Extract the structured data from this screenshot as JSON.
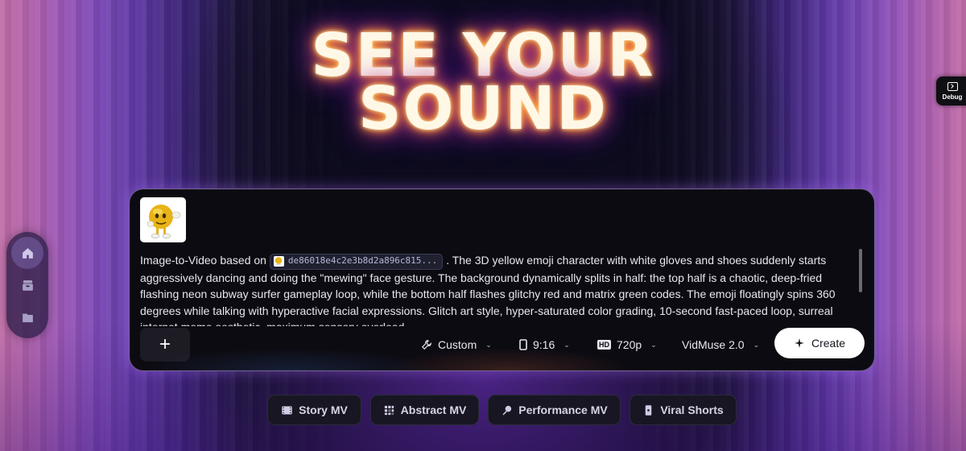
{
  "hero": {
    "line1": "SEE YOUR",
    "line2": "SOUND"
  },
  "debug": {
    "label": "Debug",
    "icon": "terminal-icon"
  },
  "left_rail": {
    "items": [
      {
        "name": "home",
        "icon": "home-icon",
        "active": true
      },
      {
        "name": "assets",
        "icon": "box-icon",
        "active": false
      },
      {
        "name": "files",
        "icon": "folder-icon",
        "active": false
      }
    ]
  },
  "composer": {
    "prompt_prefix": "Image-to-Video based on",
    "reference_chip": "de86018e4c2e3b8d2a896c815...",
    "prompt_body": ". The 3D yellow emoji character with white gloves and shoes suddenly starts aggressively dancing and doing the \"mewing\" face gesture. The background dynamically splits in half: the top half is a chaotic, deep-fried flashing neon subway surfer gameplay loop, while the bottom half flashes glitchy red and matrix green codes. The emoji floatingly spins 360 degrees while talking with hyperactive facial expressions. Glitch art style, hyper-saturated color grading, 10-second fast-paced loop, surreal internet meme aesthetic, maximum sensory overload.",
    "add_label": "+",
    "style_select": "Custom",
    "ratio_select": "9:16",
    "quality_badge": "HD",
    "quality_select": "720p",
    "model_select": "VidMuse 2.0",
    "create_label": "Create"
  },
  "presets": [
    {
      "label": "Story MV",
      "icon": "film-icon"
    },
    {
      "label": "Abstract MV",
      "icon": "grid-icon"
    },
    {
      "label": "Performance MV",
      "icon": "microphone-icon"
    },
    {
      "label": "Viral Shorts",
      "icon": "phone-icon"
    }
  ],
  "colors": {
    "accent_glow": "#b06bff",
    "create_bg": "#ffffff",
    "card_bg": "#0c0b12"
  }
}
